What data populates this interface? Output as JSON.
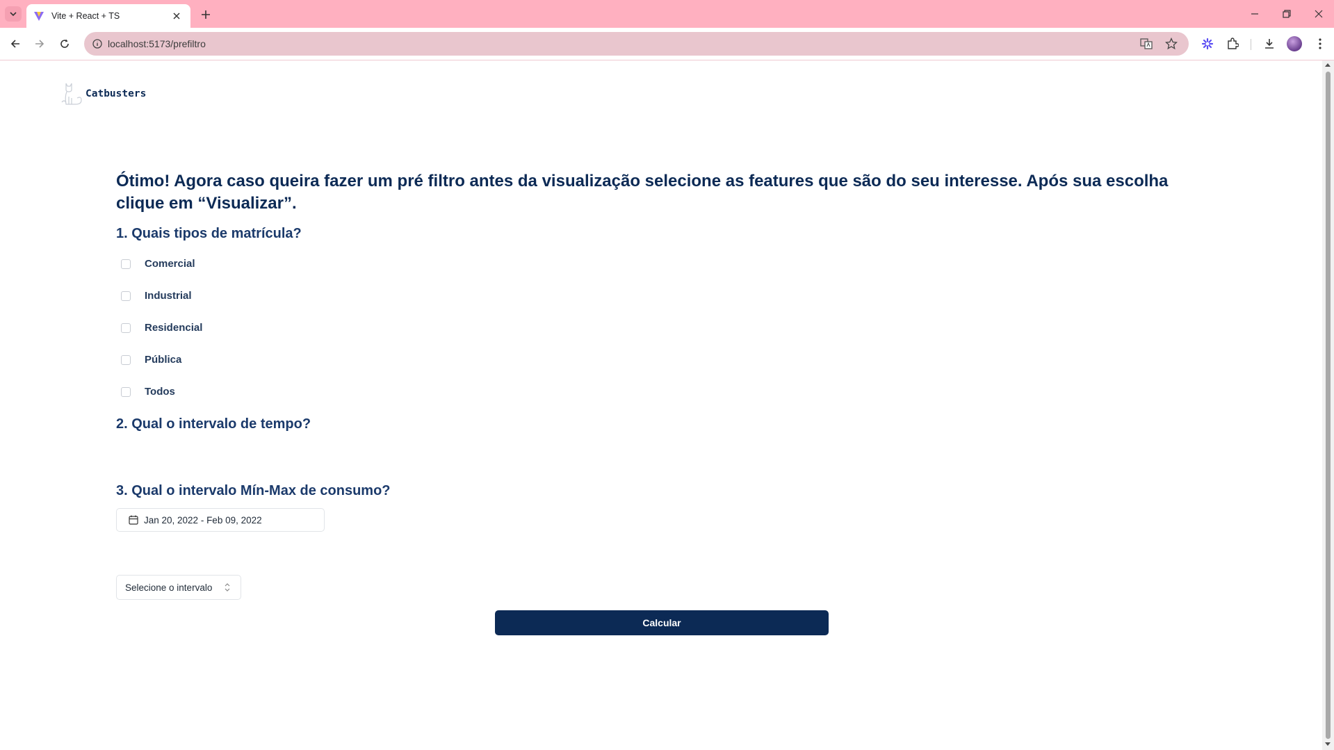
{
  "browser": {
    "tab_title": "Vite + React + TS",
    "url": "localhost:5173/prefiltro"
  },
  "brand": {
    "name": "Catbusters"
  },
  "page": {
    "headline": "Ótimo! Agora caso queira fazer um pré filtro antes da visualização selecione as features que são do seu interesse. Após sua escolha clique em “Visualizar”.",
    "question1": "1. Quais tipos de matrícula?",
    "options": [
      {
        "label": "Comercial",
        "checked": false
      },
      {
        "label": "Industrial",
        "checked": false
      },
      {
        "label": "Residencial",
        "checked": false
      },
      {
        "label": "Pública",
        "checked": false
      },
      {
        "label": "Todos",
        "checked": false
      }
    ],
    "question2": "2. Qual o intervalo de tempo?",
    "date_range": "Jan 20, 2022 - Feb 09, 2022",
    "question3": "3. Qual o intervalo Mín-Max de consumo?",
    "select_placeholder": "Selecione o intervalo",
    "calculate_button": "Calcular"
  },
  "colors": {
    "brand_navy": "#0c2a55",
    "tabbar_pink": "#ffb0c0",
    "omnibox_pink": "#e9c6ce"
  },
  "icons": [
    "tab-list-icon",
    "vite-favicon",
    "close-icon",
    "plus-icon",
    "minimize-icon",
    "restore-icon",
    "window-close-icon",
    "back-icon",
    "forward-icon",
    "reload-icon",
    "site-info-icon",
    "translate-icon",
    "star-icon",
    "extension-flower-icon",
    "puzzle-icon",
    "download-icon",
    "menu-dots-icon",
    "cat-logo-icon",
    "calendar-icon",
    "chevron-updown-icon"
  ]
}
